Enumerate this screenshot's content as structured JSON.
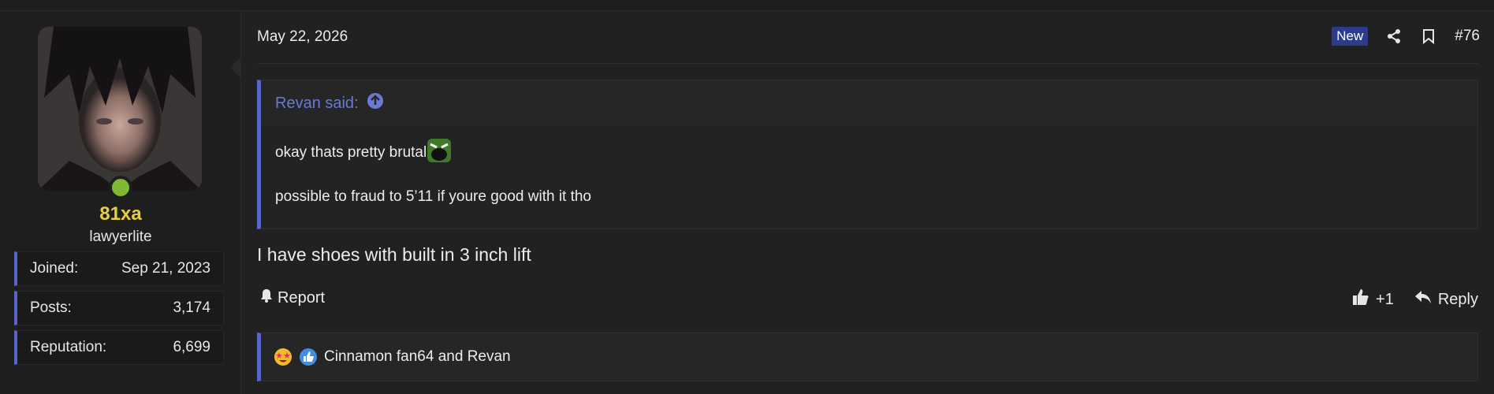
{
  "user": {
    "name": "81xa",
    "title": "lawyerlite",
    "stats": [
      {
        "label": "Joined:",
        "value": "Sep 21, 2023"
      },
      {
        "label": "Posts:",
        "value": "3,174"
      },
      {
        "label": "Reputation:",
        "value": "6,699"
      }
    ]
  },
  "post": {
    "date": "May 22, 2026",
    "badge": "New",
    "number": "#76",
    "quote": {
      "author_line": "Revan said:",
      "line1": "okay thats pretty brutal",
      "line2": "possible to fraud to 5’11 if youre good with it tho"
    },
    "text": "I have shoes with built in 3 inch lift",
    "report_label": "Report",
    "like_label": "+1",
    "reply_label": "Reply",
    "reactions_text": "Cinnamon fan64 and Revan"
  },
  "colors": {
    "accent": "#5865c9",
    "username": "#e8cf3a",
    "online": "#7fb832",
    "badge": "#2b3c8c"
  },
  "icons": [
    "share-icon",
    "bookmark-icon",
    "arrow-up-circle-icon",
    "bell-icon",
    "thumbs-up-icon",
    "reply-icon",
    "star-struck-reaction-icon",
    "like-reaction-icon",
    "screaming-emoji-icon"
  ]
}
